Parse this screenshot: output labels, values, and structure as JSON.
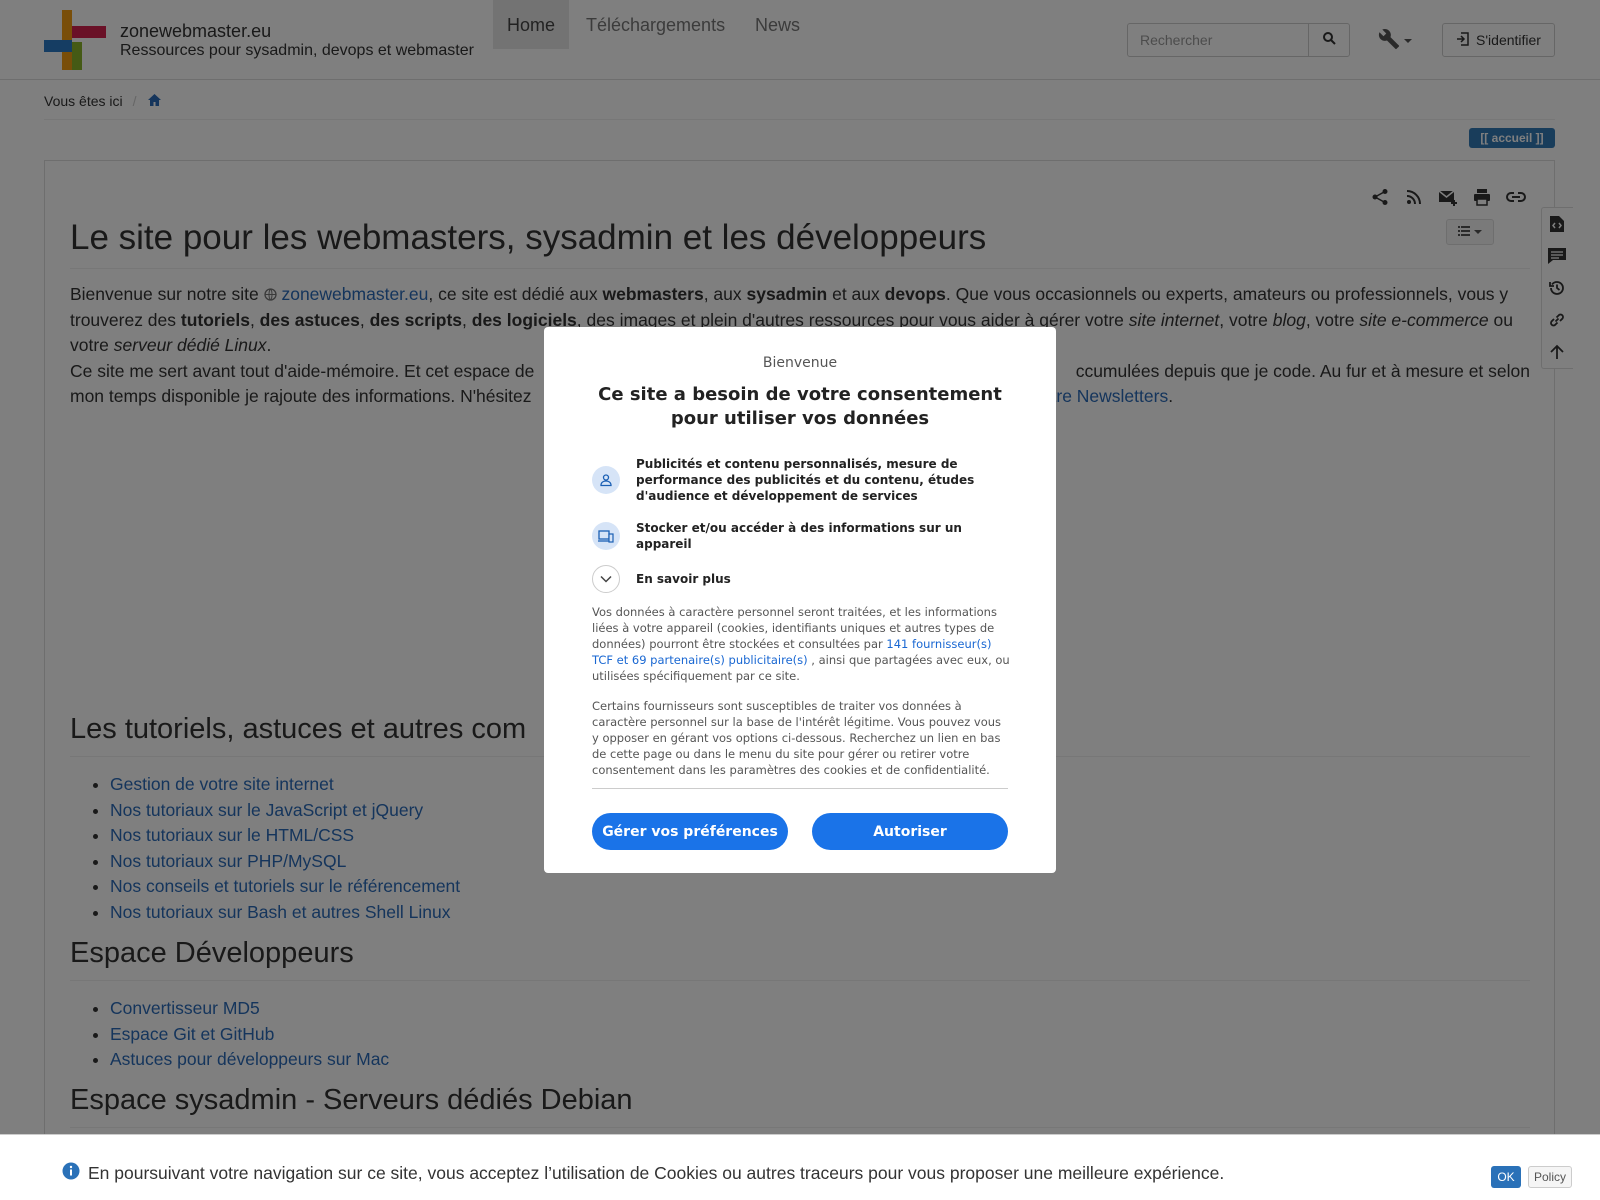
{
  "brand": {
    "title": "zonewebmaster.eu",
    "subtitle": "Ressources pour sysadmin, devops et webmaster",
    "colors": [
      "#d5234f",
      "#f39c12",
      "#2a7ac6",
      "#8ab42a"
    ]
  },
  "nav": {
    "tabs": [
      {
        "label": "Home",
        "active": true
      },
      {
        "label": "Téléchargements",
        "active": false
      },
      {
        "label": "News",
        "active": false
      }
    ]
  },
  "search": {
    "placeholder": "Rechercher",
    "icon": "search-icon"
  },
  "tools": {
    "icon": "wrench-icon"
  },
  "login": {
    "label": "S'identifier",
    "icon": "login-icon"
  },
  "breadcrumb": {
    "label": "Vous êtes ici",
    "separator": "/",
    "icon": "home-icon"
  },
  "accueil_badge": "[[ accueil ]]",
  "page_tools": [
    "share-icon",
    "rss-icon",
    "mail-add-icon",
    "print-icon",
    "link-icon"
  ],
  "side_tools": [
    "source-icon",
    "comment-icon",
    "history-icon",
    "backlink-icon",
    "back-to-top-icon"
  ],
  "page": {
    "title": "Le site pour les webmasters, sysadmin et les développeurs",
    "intro": {
      "p1_a": "Bienvenue sur notre site ",
      "site_link": "zonewebmaster.eu",
      "p1_b": ", ce site est dédié aux ",
      "b1": "webmasters",
      "p1_c": ", aux ",
      "b2": "sysadmin",
      "p1_d": " et aux ",
      "b3": "devops",
      "p1_e": ". Que vous occasionnels ou experts, amateurs ou professionnels, vous y trouverez des ",
      "b4": "tutoriels",
      "p1_f": ", ",
      "b5": "des astuces",
      "p1_g": ", ",
      "b6": "des scripts",
      "p1_h": ", ",
      "b7": "des logiciels",
      "p1_i": ", des images et plein d'autres ressources pour vous aider à gérer votre ",
      "i1": "site internet",
      "p1_j": ", votre ",
      "i2": "blog",
      "p1_k": ", votre ",
      "i3": "site e-commerce",
      "p1_l": " ou votre ",
      "i4": "serveur dédié Linux",
      "p1_m": ".",
      "p2_a": "Ce site me sert avant tout d'aide-mémoire. Et cet espace de",
      "p2_b": "ccumulées depuis que je code. Au fur et à mesure et selon",
      "p3_a": "mon temps disponible je rajoute des informations. N'hésitez",
      "p3_link": "tre Newsletters",
      "p3_end": "."
    },
    "sections": [
      {
        "title": "Les tutoriels, astuces et autres com",
        "items": [
          "Gestion de votre site internet",
          "Nos tutoriaux sur le JavaScript et jQuery",
          "Nos tutoriaux sur le HTML/CSS",
          "Nos tutoriaux sur PHP/MySQL",
          "Nos conseils et tutoriels sur le référencement",
          "Nos tutoriaux sur Bash et autres Shell Linux"
        ]
      },
      {
        "title": "Espace Développeurs",
        "items": [
          "Convertisseur MD5",
          "Espace Git et GitHub",
          "Astuces pour développeurs sur Mac"
        ]
      },
      {
        "title": "Espace sysadmin - Serveurs dédiés Debian",
        "items": []
      }
    ]
  },
  "consent": {
    "welcome": "Bienvenue",
    "headline": "Ce site a besoin de votre consentement pour utiliser vos données",
    "purposes": [
      {
        "icon": "person-icon",
        "text": "Publicités et contenu personnalisés, mesure de performance des publicités et du contenu, études d'audience et développement de services"
      },
      {
        "icon": "devices-icon",
        "text": "Stocker et/ou accéder à des informations sur un appareil"
      },
      {
        "icon": "chevron-down-icon",
        "text": "En savoir plus"
      }
    ],
    "para1_a": "Vos données à caractère personnel seront traitées, et les informations liées à votre appareil (cookies, identifiants uniques et autres types de données) pourront être stockées et consultées par ",
    "para1_link": "141 fournisseur(s) TCF et 69 partenaire(s) publicitaire(s)",
    "para1_b": " , ainsi que partagées avec eux, ou utilisées spécifiquement par ce site.",
    "para2": "Certains fournisseurs sont susceptibles de traiter vos données à caractère personnel sur la base de l'intérêt légitime. Vous pouvez vous y opposer en gérant vos options ci-dessous. Recherchez un lien en bas de cette page ou dans le menu du site pour gérer ou retirer votre consentement dans les paramètres des cookies et de confidentialité.",
    "manage_label": "Gérer vos préférences",
    "accept_label": "Autoriser",
    "accent": "#1a73e8"
  },
  "cookie_bar": {
    "text": "En poursuivant votre navigation sur ce site, vous acceptez l’utilisation de Cookies ou autres traceurs pour vous proposer une meilleure expérience.",
    "ok_label": "OK",
    "policy_label": "Policy",
    "icon": "info-icon"
  }
}
